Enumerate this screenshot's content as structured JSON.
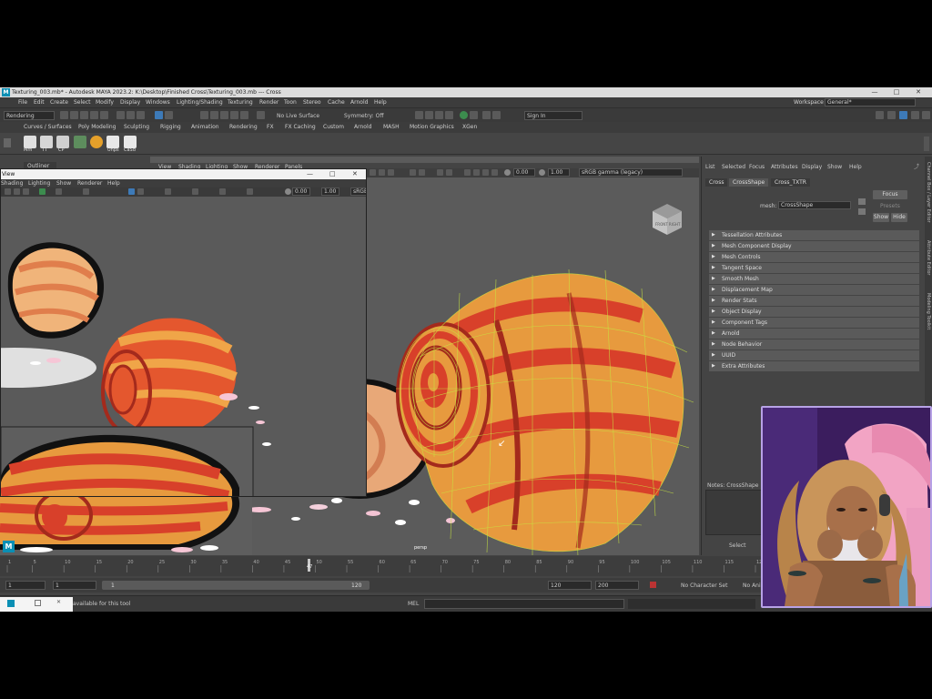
{
  "window": {
    "title": "Texturing_003.mb* - Autodesk MAYA 2023.2: K:\\Desktop\\Finished Cross\\Texturing_003.mb --- Cross",
    "icon": "M",
    "controls": [
      "—",
      "□",
      "✕"
    ]
  },
  "menubar": {
    "items": [
      "File",
      "Edit",
      "Create",
      "Select",
      "Modify",
      "Display",
      "Windows",
      "Lighting/Shading",
      "Texturing",
      "Render",
      "Toon",
      "Stereo",
      "Cache",
      "Arnold",
      "Help"
    ],
    "workspace_label": "Workspace :",
    "workspace_value": "General*"
  },
  "statusline": {
    "mode": "Rendering",
    "no_live_surface": "No Live Surface",
    "symmetry": "Symmetry: Off",
    "sign_in": "Sign In"
  },
  "shelf": {
    "tabs": [
      "Curves / Surfaces",
      "Poly Modeling",
      "Sculpting",
      "Rigging",
      "Animation",
      "Rendering",
      "FX",
      "FX Caching",
      "Custom",
      "Arnold",
      "MASH",
      "Motion Graphics",
      "XGen"
    ],
    "icon_labels": [
      "Mrn",
      "TT",
      "CP",
      "",
      "",
      "Unps",
      "CaSd"
    ]
  },
  "outliner": {
    "label": "Outliner"
  },
  "viewport": {
    "menus": [
      "View",
      "Shading",
      "Lighting",
      "Show",
      "Renderer",
      "Panels"
    ],
    "field_a": "0.00",
    "field_b": "1.00",
    "color_space": "sRGB gamma (legacy)",
    "camera_label": "persp",
    "viewcube": "FRONT RIGHT"
  },
  "ref_window": {
    "title": "View",
    "menus": [
      "Shading",
      "Lighting",
      "Show",
      "Renderer",
      "Help"
    ],
    "field_a": "0.00",
    "field_b": "1.00",
    "color_space": "sRGB"
  },
  "attribute_editor": {
    "menus": [
      "List",
      "Selected",
      "Focus",
      "Attributes",
      "Display",
      "Show",
      "Help"
    ],
    "tabs": [
      "Cross",
      "CrossShape",
      "Cross_TXTR"
    ],
    "mesh_label": "mesh:",
    "mesh_value": "CrossShape",
    "buttons": {
      "focus": "Focus",
      "presets": "Presets",
      "show": "Show",
      "hide": "Hide"
    },
    "sections": [
      "Tessellation Attributes",
      "Mesh Component Display",
      "Mesh Controls",
      "Tangent Space",
      "Smooth Mesh",
      "Displacement Map",
      "Render Stats",
      "Object Display",
      "Component Tags",
      "Arnold",
      "Node Behavior",
      "UUID",
      "Extra Attributes"
    ],
    "notes_label": "Notes: CrossShape",
    "select_button": "Select",
    "side_tabs": [
      "Channel Box / Layer Editor",
      "Attribute Editor",
      "Modeling Toolkit"
    ]
  },
  "timeslider": {
    "ticks": [
      "1",
      "5",
      "10",
      "15",
      "20",
      "25",
      "30",
      "35",
      "40",
      "45",
      "50",
      "55",
      "60",
      "65",
      "70",
      "75",
      "80",
      "85",
      "90",
      "95",
      "100",
      "105",
      "110",
      "115",
      "120"
    ],
    "current_frame": "47"
  },
  "rangebar": {
    "start": "1",
    "start_inner": "1",
    "inner_left": "1",
    "inner_right": "120",
    "end_inner": "120",
    "end": "200",
    "character_set": "No Character Set",
    "anim_layer": "No Anim Layer"
  },
  "cmdline": {
    "lang": "MEL",
    "help_text": "available for this tool"
  },
  "colors": {
    "shell_orange": "#e89a3c",
    "shell_red": "#d8402a",
    "shell_dark": "#a42a1c",
    "wireframe": "#c8e640",
    "cam_border": "#b7a2e6"
  }
}
